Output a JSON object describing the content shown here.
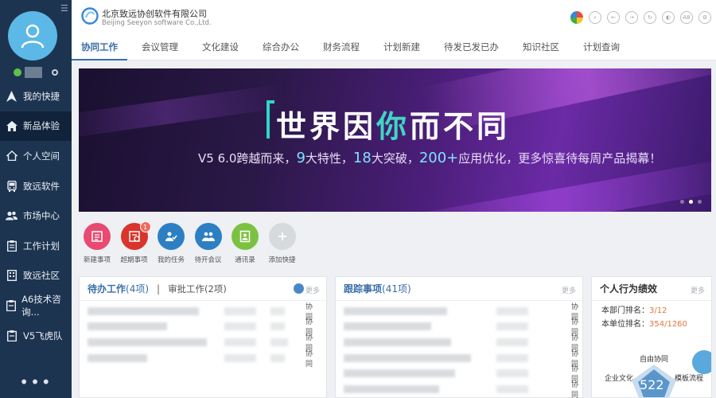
{
  "sidebar": {
    "items": [
      {
        "label": "我的快捷",
        "icon": "navigation-arrow-icon"
      },
      {
        "label": "新品体验",
        "icon": "home-icon",
        "active": true
      },
      {
        "label": "个人空间",
        "icon": "house-outline-icon"
      },
      {
        "label": "致远软件",
        "icon": "bus-icon"
      },
      {
        "label": "市场中心",
        "icon": "users-icon"
      },
      {
        "label": "工作计划",
        "icon": "clipboard-icon"
      },
      {
        "label": "致远社区",
        "icon": "building-icon"
      },
      {
        "label": "A6技术咨询...",
        "icon": "document-icon"
      },
      {
        "label": "V5飞虎队",
        "icon": "document-icon"
      }
    ],
    "more": "•••"
  },
  "header": {
    "company_cn": "北京致远协创软件有限公司",
    "company_en": "Beijing Seeyon software Co.,Ltd.",
    "tools": [
      "color-wheel-icon",
      "search-icon",
      "back-icon",
      "forward-icon",
      "refresh-icon",
      "share-icon",
      "font-size-icon",
      "settings-icon"
    ],
    "font_tool_label": "A8",
    "tabs": [
      "协同工作",
      "会议管理",
      "文化建设",
      "综合办公",
      "财务流程",
      "计划新建",
      "待发已发已办",
      "知识社区",
      "计划查询"
    ]
  },
  "banner": {
    "title_part1": "世界因",
    "title_hl": "你",
    "title_part2": "而不同",
    "sub_prefix": "V5 6.0跨越而来，",
    "sub_num1": "9",
    "sub_text1": "大特性，",
    "sub_num2": "18",
    "sub_text2": "大突破，",
    "sub_num3": "200+",
    "sub_text3": "应用优化，更多惊喜待每周产品揭幕！"
  },
  "shortcuts": [
    {
      "label": "新建事项",
      "color": "#e84a72",
      "icon": "new-item-icon"
    },
    {
      "label": "超期事项",
      "color": "#d8352c",
      "icon": "overdue-icon",
      "badge": "1"
    },
    {
      "label": "我的任务",
      "color": "#2d7fc4",
      "icon": "task-icon"
    },
    {
      "label": "待开会议",
      "color": "#2d7fc4",
      "icon": "meeting-icon"
    },
    {
      "label": "通讯录",
      "color": "#7cc242",
      "icon": "contacts-icon"
    },
    {
      "label": "添加快捷",
      "color": "#d7dadd",
      "icon": "plus-icon"
    }
  ],
  "todo_panel": {
    "title": "待办工作",
    "count": "(4项)",
    "divider": "|",
    "second_tab": "审批工作(2项)",
    "more": "更多",
    "rows": [
      {
        "tag": "协同"
      },
      {
        "tag": "协同"
      },
      {
        "tag": "协同"
      },
      {
        "tag": "协同"
      }
    ]
  },
  "track_panel": {
    "title": "跟踪事项",
    "count": "(41项)",
    "more": "更多",
    "rows": [
      {
        "tag": "协同"
      },
      {
        "tag": "协同"
      },
      {
        "tag": "协同"
      },
      {
        "tag": "协同"
      },
      {
        "tag": "协同"
      },
      {
        "tag": "协同"
      }
    ]
  },
  "perf_panel": {
    "title": "个人行为绩效",
    "more": "更多",
    "dept_rank_label": "本部门排名：",
    "dept_rank_value": "3/12",
    "unit_rank_label": "本单位排名：",
    "unit_rank_value": "354/1260",
    "radar_top": "自由协同",
    "radar_left": "企业文化",
    "radar_right": "模板流程",
    "radar_score": "522"
  }
}
